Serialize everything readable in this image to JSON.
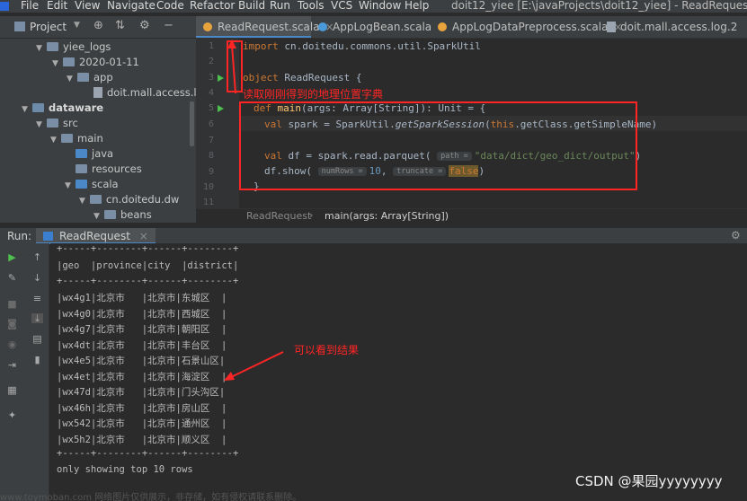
{
  "menu": [
    "File",
    "Edit",
    "View",
    "Navigate",
    "Code",
    "Refactor",
    "Build",
    "Run",
    "Tools",
    "VCS",
    "Window",
    "Help"
  ],
  "window_title": "doit12_yiee [E:\\javaProjects\\doit12_yiee] - ReadRequest.scala [data",
  "project_panel": {
    "label": "Project",
    "tree": [
      {
        "name": "yiee_logs",
        "kind": "folder"
      },
      {
        "name": "2020-01-11",
        "kind": "folder"
      },
      {
        "name": "app",
        "kind": "folder"
      },
      {
        "name": "doit.mall.access.log.",
        "kind": "file"
      },
      {
        "name": "dataware",
        "kind": "module"
      },
      {
        "name": "src",
        "kind": "folder"
      },
      {
        "name": "main",
        "kind": "folder"
      },
      {
        "name": "java",
        "kind": "source"
      },
      {
        "name": "resources",
        "kind": "folder"
      },
      {
        "name": "scala",
        "kind": "source"
      },
      {
        "name": "cn.doitedu.dw",
        "kind": "package"
      },
      {
        "name": "beans",
        "kind": "package"
      }
    ]
  },
  "tabs": [
    {
      "label": "ReadRequest.scala",
      "active": true
    },
    {
      "label": "AppLogBean.scala",
      "active": false
    },
    {
      "label": "AppLogDataPreprocess.scala",
      "active": false
    },
    {
      "label": "doit.mall.access.log.2",
      "active": false
    }
  ],
  "editor": {
    "line_numbers": [
      "1",
      "2",
      "3",
      "4",
      "5",
      "6",
      "7",
      "8",
      "9",
      "10",
      "11"
    ],
    "import_kw": "import",
    "import_path": "cn.doitedu.commons.util.SparkUtil",
    "object_kw": "object",
    "object_name": "ReadRequest",
    "obj_brace": "{",
    "def_kw": "def",
    "def_name": "main",
    "def_sig": "(args: Array[String]): Unit = {",
    "val_kw": "val",
    "spark_assign": "spark = SparkUtil.",
    "spark_call": "getSparkSession",
    "spark_args_open": "(",
    "this_kw": "this",
    "spark_args_close": ".getClass.getSimpleName)",
    "df_assign": "df = spark.read.parquet(",
    "path_hint": "path =",
    "path_value": "\"data/dict/geo_dict/output\"",
    "paren_close": ")",
    "show_call": "df.show(",
    "numrows_hint": "numRows =",
    "numrows_value": "10",
    "comma": ", ",
    "truncate_hint": "truncate =",
    "truncate_value": "false",
    "close_brace": "}"
  },
  "breadcrumb": {
    "object": "ReadRequest",
    "sep": "›",
    "method": "main(args: Array[String])"
  },
  "run_panel": {
    "label": "Run:",
    "tab": "ReadRequest",
    "output": [
      "+-----+--------+------+--------+",
      "|geo  |province|city  |district|",
      "+-----+--------+------+--------+",
      "|wx4g1|北京市   |北京市|东城区  |",
      "|wx4g0|北京市   |北京市|西城区  |",
      "|wx4g7|北京市   |北京市|朝阳区  |",
      "|wx4dt|北京市   |北京市|丰台区  |",
      "|wx4e5|北京市   |北京市|石景山区|",
      "|wx4et|北京市   |北京市|海淀区  |",
      "|wx47d|北京市   |北京市|门头沟区|",
      "|wx46h|北京市   |北京市|房山区  |",
      "|wx542|北京市   |北京市|通州区  |",
      "|wx5h2|北京市   |北京市|顺义区  |",
      "+-----+--------+------+--------+",
      "only showing top 10 rows"
    ]
  },
  "annotations": {
    "read_dict": "读取刚刚得到的地理位置字典",
    "see_result": "可以看到结果"
  },
  "watermark": "CSDN @果园yyyyyyyy",
  "bottom_faint": "www.toymoban.com 网络图片仅供展示，非存储，如有侵权请联系删除。",
  "colors": {
    "annotation": "#ff2525",
    "keyword": "#cc7832",
    "function": "#ffc66d",
    "string": "#6a8759",
    "number": "#6897bb"
  }
}
